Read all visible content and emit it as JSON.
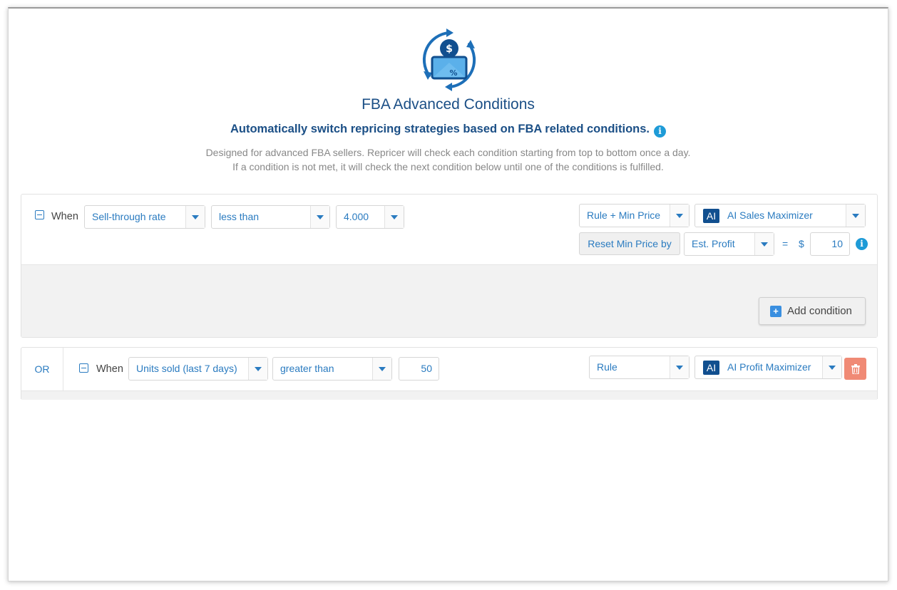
{
  "header": {
    "title": "FBA Advanced Conditions",
    "subtitle": "Automatically switch repricing strategies based on FBA related conditions.",
    "description_line1": "Designed for advanced FBA sellers. Repricer will check each condition starting from top to bottom once a day.",
    "description_line2": "If a condition is not met, it will check the next condition below until one of the conditions is fulfilled.",
    "info_glyph": "i"
  },
  "condition1": {
    "when_label": "When",
    "metric": "Sell-through rate",
    "operator": "less than",
    "value": "4.000",
    "strategy_type": "Rule + Min Price",
    "ai_badge": "AI",
    "strategy": "AI Sales Maximizer",
    "reset_label": "Reset Min Price by",
    "reset_basis": "Est. Profit",
    "equals": "=",
    "currency": "$",
    "reset_amount": "10",
    "add_condition_icon": "+",
    "add_condition_label": "Add condition"
  },
  "condition2": {
    "or_label": "OR",
    "when_label": "When",
    "metric": "Units sold (last 7 days)",
    "operator": "greater than",
    "value": "50",
    "strategy_type": "Rule",
    "ai_badge": "AI",
    "strategy": "AI Profit Maximizer"
  },
  "icons": {
    "logo": "repricing-cycle-icon",
    "info": "info-icon",
    "collapse": "minus-square-icon",
    "dropdown": "chevron-down-icon",
    "delete": "trash-icon"
  },
  "colors": {
    "brand_blue": "#1b4f86",
    "link_blue": "#2a7bc0",
    "info_blue": "#1e9bd7",
    "ai_badge_bg": "#114f8f",
    "delete_red": "#f08a75"
  }
}
